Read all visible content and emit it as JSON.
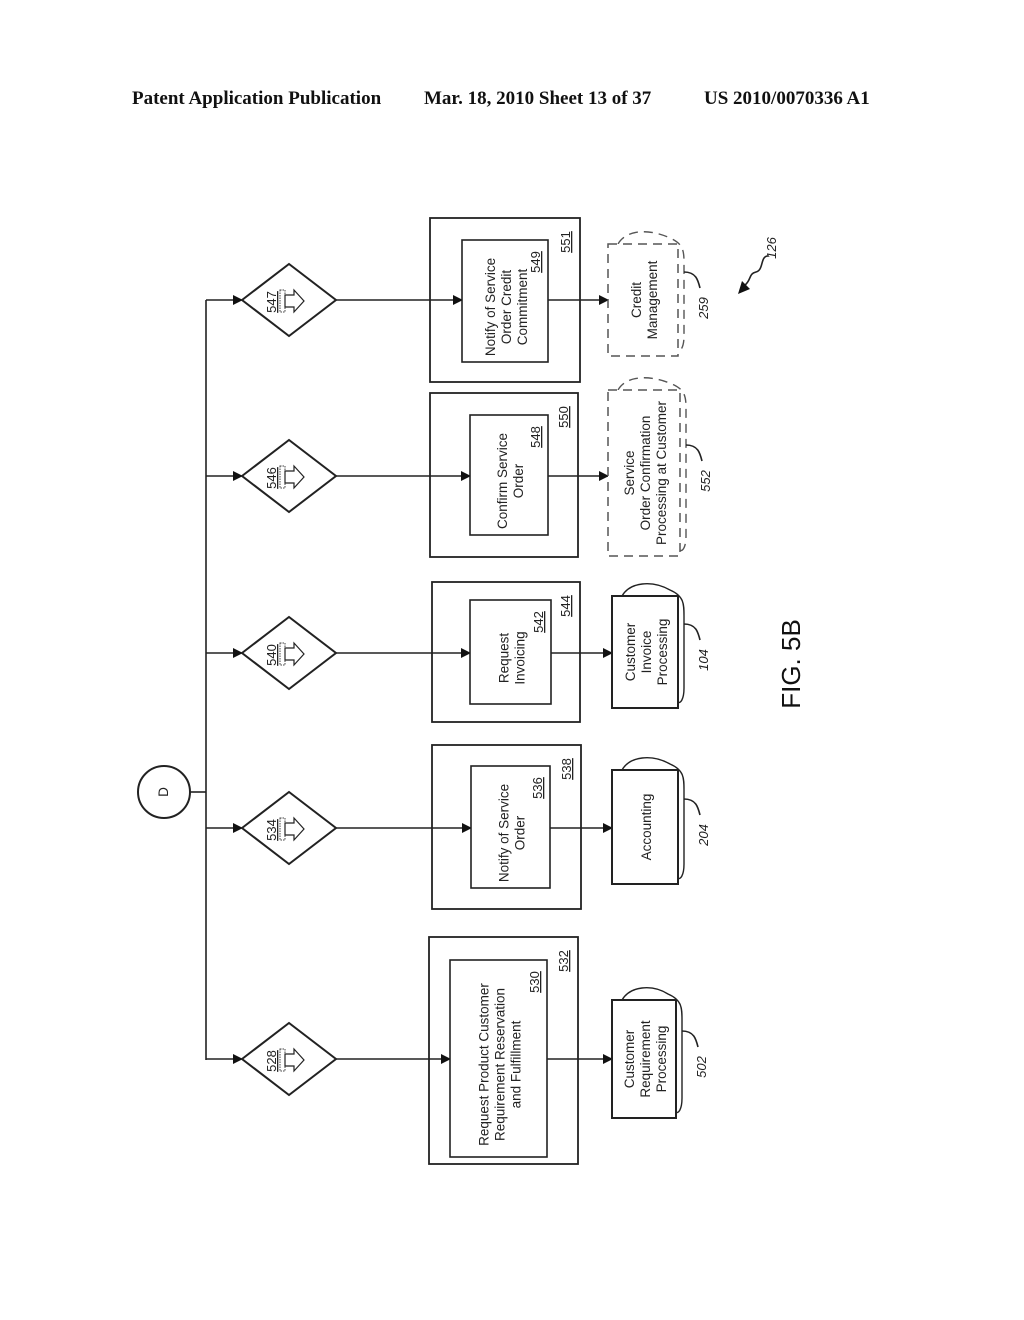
{
  "header": {
    "publication": "Patent Application Publication",
    "date_sheet": "Mar. 18, 2010  Sheet 13 of 37",
    "patent_number": "US 2010/0070336 A1"
  },
  "figure": {
    "label": "FIG. 5B",
    "reference": "126",
    "connector": "D"
  },
  "rows": [
    {
      "gate_ref": "547",
      "outer_ref": "551",
      "inner_ref": "549",
      "inner_lines": [
        "Notify of Service",
        "Order Credit",
        "Commitment"
      ],
      "target_lines": [
        "Credit",
        "Management"
      ],
      "target_ref": "259",
      "target_style": "dashed"
    },
    {
      "gate_ref": "546",
      "outer_ref": "550",
      "inner_ref": "548",
      "inner_lines": [
        "Confirm Service",
        "Order"
      ],
      "target_lines": [
        "Service",
        "Order Confirmation",
        "Processing at Customer"
      ],
      "target_ref": "552",
      "target_style": "dashed"
    },
    {
      "gate_ref": "540",
      "outer_ref": "544",
      "inner_ref": "542",
      "inner_lines": [
        "Request",
        "Invoicing"
      ],
      "target_lines": [
        "Customer",
        "Invoice",
        "Processing"
      ],
      "target_ref": "104",
      "target_style": "solid"
    },
    {
      "gate_ref": "534",
      "outer_ref": "538",
      "inner_ref": "536",
      "inner_lines": [
        "Notify of Service",
        "Order"
      ],
      "target_lines": [
        "Accounting"
      ],
      "target_ref": "204",
      "target_style": "solid"
    },
    {
      "gate_ref": "528",
      "outer_ref": "532",
      "inner_ref": "530",
      "inner_lines": [
        "Request Product Customer",
        "Requirement Reservation",
        "and Fulfillment"
      ],
      "target_lines": [
        "Customer",
        "Requirement",
        "Processing"
      ],
      "target_ref": "502",
      "target_style": "solid"
    }
  ]
}
